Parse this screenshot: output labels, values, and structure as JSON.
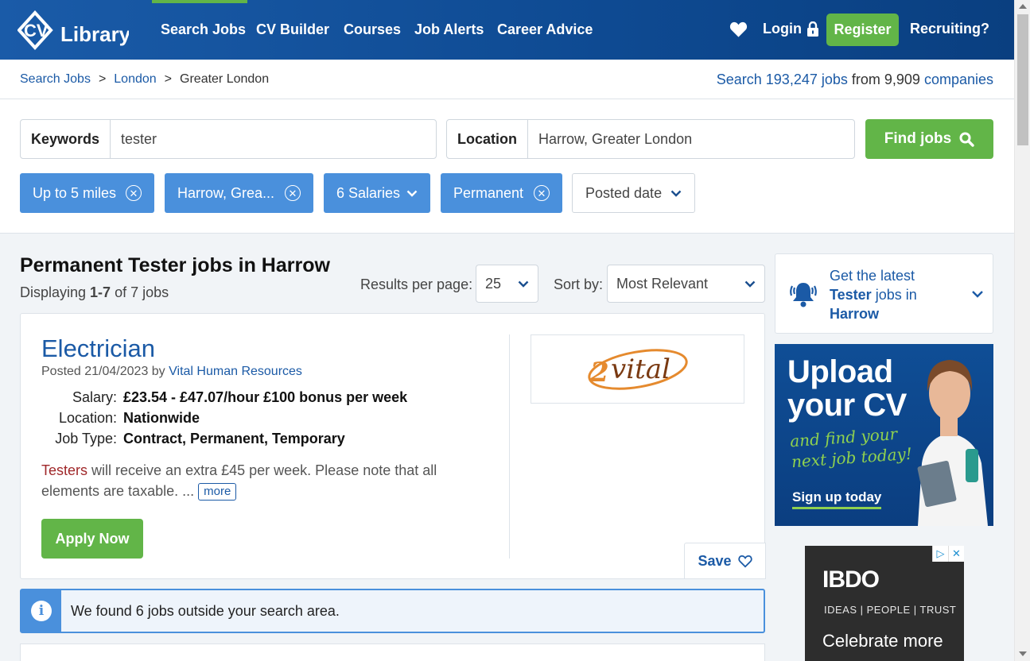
{
  "brand": {
    "logo_main": "CV",
    "logo_sub": "Library",
    "primary": "#0e4a92",
    "accent": "#62b548",
    "link": "#1b5aa6",
    "chip": "#4a90dc"
  },
  "nav": {
    "items": [
      "Search Jobs",
      "CV Builder",
      "Courses",
      "Job Alerts",
      "Career Advice"
    ],
    "login": "Login",
    "register": "Register",
    "recruiting": "Recruiting?"
  },
  "breadcrumb": {
    "items": [
      "Search Jobs",
      "London",
      "Greater London"
    ],
    "separator": ">"
  },
  "search_stats": {
    "prefix": "Search 193,247 jobs",
    "middle": "from 9,909",
    "suffix": "companies"
  },
  "search": {
    "keywords_label": "Keywords",
    "keywords_value": "tester",
    "location_label": "Location",
    "location_value": "Harrow, Greater London",
    "find_label": "Find jobs"
  },
  "filters": [
    {
      "label": "Up to 5 miles",
      "control": "remove"
    },
    {
      "label": "Harrow, Grea...",
      "control": "remove"
    },
    {
      "label": "6 Salaries",
      "control": "dropdown"
    },
    {
      "label": "Permanent",
      "control": "remove"
    },
    {
      "label": "Posted date",
      "control": "dropdown"
    }
  ],
  "results": {
    "title": "Permanent Tester jobs in Harrow",
    "displaying_prefix": "Displaying ",
    "displaying_range": "1-7",
    "displaying_suffix": " of 7 jobs",
    "rpp_label": "Results per page:",
    "rpp_value": "25",
    "sort_label": "Sort by:",
    "sort_value": "Most Relevant"
  },
  "job": {
    "title": "Electrician",
    "posted_prefix": "Posted 21/04/2023 by",
    "company": "Vital Human Resources",
    "salary_label": "Salary:",
    "salary": "£23.54 - £47.07/hour £100 bonus per week",
    "location_label": "Location:",
    "location": "Nationwide",
    "type_label": "Job Type:",
    "type": "Contract, Permanent, Temporary",
    "desc_highlight": "Testers",
    "desc_rest": " will receive an extra £45 per week. Please note that all elements are taxable. ...",
    "more": "more",
    "apply": "Apply Now",
    "save": "Save",
    "logo_text": "vital",
    "logo_initial": "2"
  },
  "notice": {
    "icon": "i",
    "text": "We found 6 jobs outside your search area."
  },
  "sidebar": {
    "alert_line1": "Get the latest",
    "alert_keyword": "Tester",
    "alert_line2": " jobs in",
    "alert_location": "Harrow",
    "cv_title_1": "Upload",
    "cv_title_2": "your CV",
    "cv_sub_1": "and find your",
    "cv_sub_2": "next job today!",
    "cv_cta": "Sign up today",
    "bdo_logo": "IBDO",
    "bdo_tagline": "IDEAS | PEOPLE | TRUST",
    "bdo_line": "Celebrate more",
    "ad_choices": "▷",
    "ad_close": "✕"
  },
  "icons": {
    "heart": "heart-icon",
    "lock": "lock-icon",
    "search": "search-icon",
    "chevron": "chevron-down-icon",
    "remove": "close-circle-icon",
    "bell": "bell-icon",
    "info": "info-icon"
  }
}
